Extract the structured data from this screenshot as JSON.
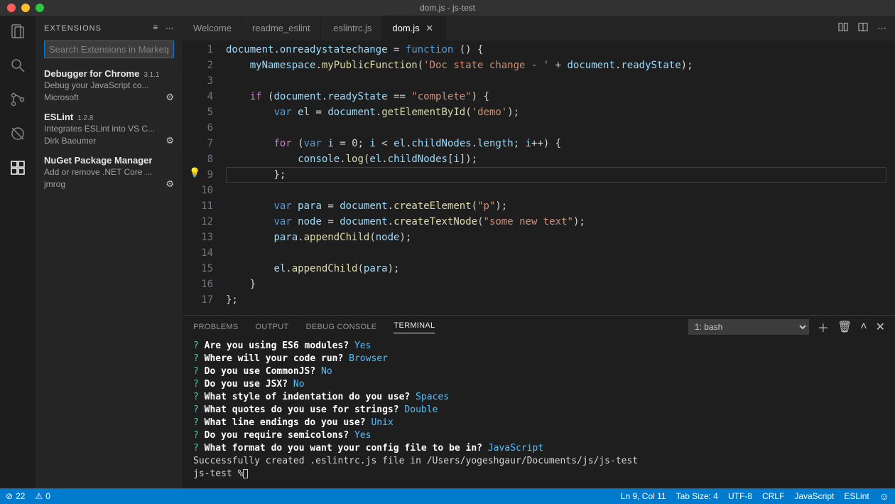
{
  "window": {
    "title": "dom.js - js-test"
  },
  "sidebar": {
    "title": "EXTENSIONS",
    "search_placeholder": "Search Extensions in Marketplace",
    "items": [
      {
        "name": "Debugger for Chrome",
        "version": "3.1.1",
        "desc": "Debug your JavaScript co...",
        "publisher": "Microsoft"
      },
      {
        "name": "ESLint",
        "version": "1.2.8",
        "desc": "Integrates ESLint into VS C...",
        "publisher": "Dirk Baeumer"
      },
      {
        "name": "NuGet Package Manager",
        "version": "",
        "desc": "Add or remove .NET Core ...",
        "publisher": "jmrog"
      }
    ]
  },
  "tabs": [
    {
      "label": "Welcome",
      "active": false
    },
    {
      "label": "readme_eslint",
      "active": false
    },
    {
      "label": ".eslintrc.js",
      "active": false
    },
    {
      "label": "dom.js",
      "active": true
    }
  ],
  "code": {
    "lines": [
      {
        "n": 1,
        "t": [
          [
            "id",
            "document"
          ],
          [
            "pn",
            "."
          ],
          [
            "id",
            "onreadystatechange"
          ],
          [
            "op",
            " = "
          ],
          [
            "bk",
            "function"
          ],
          [
            "pn",
            " () {"
          ]
        ]
      },
      {
        "n": 2,
        "t": [
          [
            "pn",
            "    "
          ],
          [
            "id",
            "myNamespace"
          ],
          [
            "pn",
            "."
          ],
          [
            "fn",
            "myPublicFunction"
          ],
          [
            "pn",
            "("
          ],
          [
            "str",
            "'Doc state change - '"
          ],
          [
            "op",
            " + "
          ],
          [
            "id",
            "document"
          ],
          [
            "pn",
            "."
          ],
          [
            "id",
            "readyState"
          ],
          [
            "pn",
            ");"
          ]
        ]
      },
      {
        "n": 3,
        "t": []
      },
      {
        "n": 4,
        "t": [
          [
            "pn",
            "    "
          ],
          [
            "kw",
            "if"
          ],
          [
            "pn",
            " ("
          ],
          [
            "id",
            "document"
          ],
          [
            "pn",
            "."
          ],
          [
            "id",
            "readyState"
          ],
          [
            "op",
            " == "
          ],
          [
            "str",
            "\"complete\""
          ],
          [
            "pn",
            ") {"
          ]
        ]
      },
      {
        "n": 5,
        "t": [
          [
            "pn",
            "        "
          ],
          [
            "bk",
            "var"
          ],
          [
            "pn",
            " "
          ],
          [
            "id",
            "el"
          ],
          [
            "op",
            " = "
          ],
          [
            "id",
            "document"
          ],
          [
            "pn",
            "."
          ],
          [
            "fn",
            "getElementById"
          ],
          [
            "pn",
            "("
          ],
          [
            "str",
            "'demo'"
          ],
          [
            "pn",
            ");"
          ]
        ]
      },
      {
        "n": 6,
        "t": []
      },
      {
        "n": 7,
        "t": [
          [
            "pn",
            "        "
          ],
          [
            "kw",
            "for"
          ],
          [
            "pn",
            " ("
          ],
          [
            "bk",
            "var"
          ],
          [
            "pn",
            " "
          ],
          [
            "id",
            "i"
          ],
          [
            "op",
            " = "
          ],
          [
            "pn",
            "0; "
          ],
          [
            "id",
            "i"
          ],
          [
            "op",
            " < "
          ],
          [
            "id",
            "el"
          ],
          [
            "pn",
            "."
          ],
          [
            "id",
            "childNodes"
          ],
          [
            "pn",
            "."
          ],
          [
            "id",
            "length"
          ],
          [
            "pn",
            "; "
          ],
          [
            "id",
            "i"
          ],
          [
            "pn",
            "++) {"
          ]
        ]
      },
      {
        "n": 8,
        "t": [
          [
            "pn",
            "            "
          ],
          [
            "id",
            "console"
          ],
          [
            "pn",
            "."
          ],
          [
            "fn",
            "log"
          ],
          [
            "pn",
            "("
          ],
          [
            "id",
            "el"
          ],
          [
            "pn",
            "."
          ],
          [
            "id",
            "childNodes"
          ],
          [
            "pn",
            "["
          ],
          [
            "id",
            "i"
          ],
          [
            "pn",
            "]);"
          ]
        ]
      },
      {
        "n": 9,
        "t": [
          [
            "pn",
            "        };"
          ]
        ]
      },
      {
        "n": 10,
        "t": []
      },
      {
        "n": 11,
        "t": [
          [
            "pn",
            "        "
          ],
          [
            "bk",
            "var"
          ],
          [
            "pn",
            " "
          ],
          [
            "id",
            "para"
          ],
          [
            "op",
            " = "
          ],
          [
            "id",
            "document"
          ],
          [
            "pn",
            "."
          ],
          [
            "fn",
            "createElement"
          ],
          [
            "pn",
            "("
          ],
          [
            "str",
            "\"p\""
          ],
          [
            "pn",
            ");"
          ]
        ]
      },
      {
        "n": 12,
        "t": [
          [
            "pn",
            "        "
          ],
          [
            "bk",
            "var"
          ],
          [
            "pn",
            " "
          ],
          [
            "id",
            "node"
          ],
          [
            "op",
            " = "
          ],
          [
            "id",
            "document"
          ],
          [
            "pn",
            "."
          ],
          [
            "fn",
            "createTextNode"
          ],
          [
            "pn",
            "("
          ],
          [
            "str",
            "\"some new text\""
          ],
          [
            "pn",
            ");"
          ]
        ]
      },
      {
        "n": 13,
        "t": [
          [
            "pn",
            "        "
          ],
          [
            "id",
            "para"
          ],
          [
            "pn",
            "."
          ],
          [
            "fn",
            "appendChild"
          ],
          [
            "pn",
            "("
          ],
          [
            "id",
            "node"
          ],
          [
            "pn",
            ");"
          ]
        ]
      },
      {
        "n": 14,
        "t": []
      },
      {
        "n": 15,
        "t": [
          [
            "pn",
            "        "
          ],
          [
            "id",
            "el"
          ],
          [
            "pn",
            "."
          ],
          [
            "fn",
            "appendChild"
          ],
          [
            "pn",
            "("
          ],
          [
            "id",
            "para"
          ],
          [
            "pn",
            ");"
          ]
        ]
      },
      {
        "n": 16,
        "t": [
          [
            "pn",
            "    }"
          ]
        ]
      },
      {
        "n": 17,
        "t": [
          [
            "pn",
            "};"
          ]
        ]
      }
    ]
  },
  "panel": {
    "tabs": [
      "PROBLEMS",
      "OUTPUT",
      "DEBUG CONSOLE",
      "TERMINAL"
    ],
    "active": 3,
    "terminal_selector": "1: bash",
    "lines": [
      {
        "q": "Are you using ES6 modules?",
        "a": "Yes"
      },
      {
        "q": "Where will your code run?",
        "a": "Browser"
      },
      {
        "q": "Do you use CommonJS?",
        "a": "No"
      },
      {
        "q": "Do you use JSX?",
        "a": "No"
      },
      {
        "q": "What style of indentation do you use?",
        "a": "Spaces"
      },
      {
        "q": "What quotes do you use for strings?",
        "a": "Double"
      },
      {
        "q": "What line endings do you use?",
        "a": "Unix"
      },
      {
        "q": "Do you require semicolons?",
        "a": "Yes"
      },
      {
        "q": "What format do you want your config file to be in?",
        "a": "JavaScript"
      }
    ],
    "trailer1": "Successfully created .eslintrc.js file in /Users/yogeshgaur/Documents/js/js-test",
    "trailer2": "js-test %"
  },
  "statusbar": {
    "errors": "22",
    "warnings": "0",
    "ln_col": "Ln 9, Col 11",
    "tab_size": "Tab Size: 4",
    "encoding": "UTF-8",
    "eol": "CRLF",
    "lang": "JavaScript",
    "eslint": "ESLint"
  }
}
